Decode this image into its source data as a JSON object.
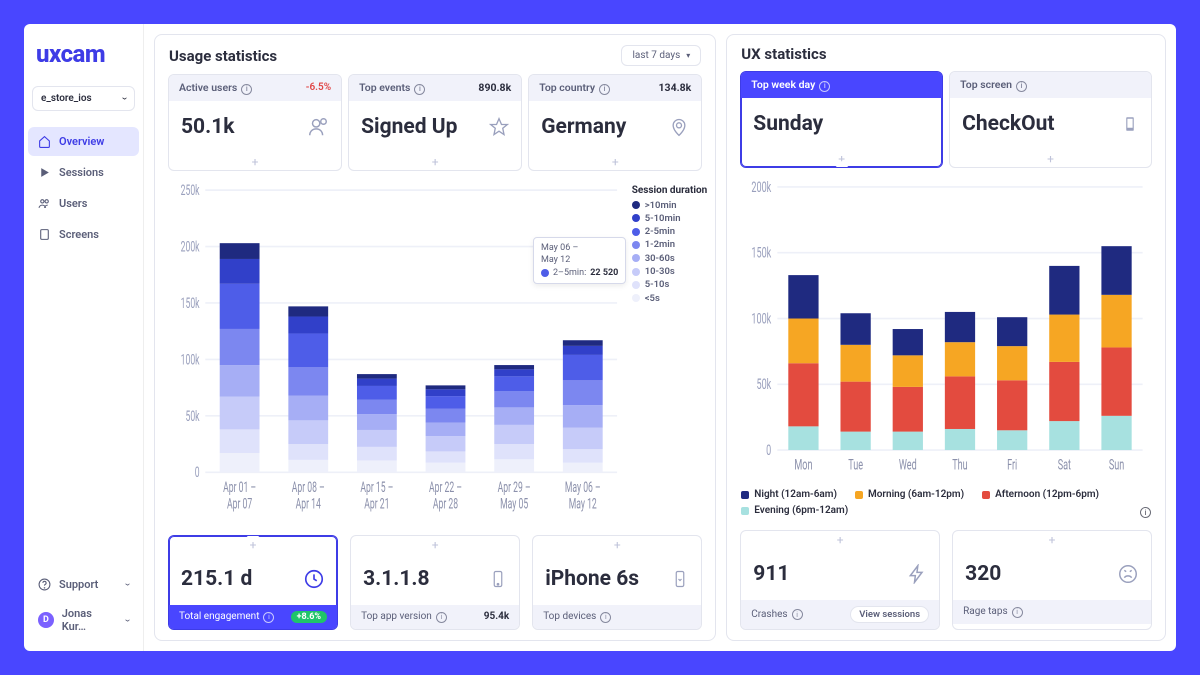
{
  "brand": {
    "part1": "ux",
    "part2": "cam"
  },
  "app_selector": {
    "name": "e_store_ios"
  },
  "nav": {
    "items": [
      {
        "label": "Overview",
        "icon": "home"
      },
      {
        "label": "Sessions",
        "icon": "play"
      },
      {
        "label": "Users",
        "icon": "users"
      },
      {
        "label": "Screens",
        "icon": "screen"
      }
    ]
  },
  "footer": {
    "support": "Support",
    "user_initial": "D",
    "user_name": "Jonas Kur…"
  },
  "usage": {
    "title": "Usage statistics",
    "range": "last 7 days",
    "top_metrics": [
      {
        "label": "Active users",
        "stat": "-6.5%",
        "value": "50.1k",
        "icon": "person"
      },
      {
        "label": "Top events",
        "stat": "890.8k",
        "value": "Signed Up",
        "icon": "star"
      },
      {
        "label": "Top country",
        "stat": "134.8k",
        "value": "Germany",
        "icon": "pin"
      }
    ],
    "bottom_metrics": [
      {
        "value": "215.1 d",
        "label": "Total engagement",
        "stat": "+8.6%",
        "icon": "clock"
      },
      {
        "value": "3.1.1.8",
        "label": "Top app version",
        "stat": "95.4k",
        "icon": "phone"
      },
      {
        "value": "iPhone 6s",
        "label": "Top devices",
        "stat": "",
        "icon": "phone-down"
      }
    ],
    "chart_tooltip": {
      "line1": "May 06 –",
      "line2": "May 12",
      "line3": "2–5min:",
      "value": "22 520"
    }
  },
  "ux": {
    "title": "UX statistics",
    "top_metrics": [
      {
        "label": "Top week day",
        "value": "Sunday"
      },
      {
        "label": "Top screen",
        "value": "CheckOut",
        "icon": "device"
      }
    ],
    "legend": [
      {
        "label": "Night (12am-6am)",
        "color": "#1f2a80"
      },
      {
        "label": "Morning (6am-12pm)",
        "color": "#f6a623"
      },
      {
        "label": "Afternoon (12pm-6pm)",
        "color": "#e34b3f"
      },
      {
        "label": "Evening (6pm-12am)",
        "color": "#a7e1e0"
      }
    ],
    "bottom_metrics": [
      {
        "value": "911",
        "label": "Crashes",
        "action": "View sessions",
        "icon": "bolt"
      },
      {
        "value": "320",
        "label": "Rage taps",
        "icon": "angry"
      }
    ]
  },
  "chart_data": [
    {
      "id": "session_duration",
      "type": "bar",
      "stacked": true,
      "title": "",
      "ylabel": "",
      "ylim": [
        0,
        250000
      ],
      "yticks": [
        0,
        50000,
        100000,
        150000,
        200000,
        250000
      ],
      "ytick_labels": [
        "0",
        "50k",
        "100k",
        "150k",
        "200k",
        "250k"
      ],
      "categories": [
        "Apr 01 –\nApr 07",
        "Apr 08 –\nApr 14",
        "Apr 15 –\nApr 21",
        "Apr 22 –\nApr 28",
        "Apr 29 –\nMay 05",
        "May 06 –\nMay 12"
      ],
      "legend_title": "Session duration",
      "series": [
        {
          "name": ">10min",
          "color": "#1f2a80",
          "values": [
            14000,
            9000,
            4000,
            3500,
            3800,
            5000
          ]
        },
        {
          "name": "5-10min",
          "color": "#3140c9",
          "values": [
            22000,
            15000,
            6500,
            6000,
            6200,
            8000
          ]
        },
        {
          "name": "2-5min",
          "color": "#4e5de8",
          "values": [
            40000,
            30000,
            12000,
            11000,
            13000,
            22520
          ]
        },
        {
          "name": "1-2min",
          "color": "#7c87f0",
          "values": [
            32000,
            25000,
            13000,
            12500,
            14500,
            22000
          ]
        },
        {
          "name": "30-60s",
          "color": "#a6aef5",
          "values": [
            28000,
            22000,
            14000,
            12000,
            15500,
            20000
          ]
        },
        {
          "name": "10-30s",
          "color": "#c6cbf9",
          "values": [
            29000,
            21000,
            15000,
            13500,
            17000,
            19000
          ]
        },
        {
          "name": "5-10s",
          "color": "#dfe2fb",
          "values": [
            21000,
            14000,
            12000,
            10000,
            13500,
            12000
          ]
        },
        {
          "name": "<5s",
          "color": "#eef0fb",
          "values": [
            17000,
            11000,
            10500,
            8500,
            11500,
            8480
          ]
        }
      ]
    },
    {
      "id": "weekday_sessions",
      "type": "bar",
      "stacked": true,
      "title": "",
      "ylabel": "",
      "ylim": [
        0,
        200000
      ],
      "yticks": [
        0,
        50000,
        100000,
        150000,
        200000
      ],
      "ytick_labels": [
        "0",
        "50k",
        "100k",
        "150k",
        "200k"
      ],
      "categories": [
        "Mon",
        "Tue",
        "Wed",
        "Thu",
        "Fri",
        "Sat",
        "Sun"
      ],
      "series": [
        {
          "name": "Evening (6pm-12am)",
          "color": "#a7e1e0",
          "values": [
            18000,
            14000,
            14000,
            16000,
            15000,
            22000,
            26000
          ]
        },
        {
          "name": "Afternoon (12pm-6pm)",
          "color": "#e34b3f",
          "values": [
            48000,
            38000,
            34000,
            40000,
            38000,
            45000,
            52000
          ]
        },
        {
          "name": "Morning (6am-12pm)",
          "color": "#f6a623",
          "values": [
            34000,
            28000,
            24000,
            26000,
            26000,
            36000,
            40000
          ]
        },
        {
          "name": "Night (12am-6am)",
          "color": "#1f2a80",
          "values": [
            33000,
            24000,
            20000,
            23000,
            22000,
            37000,
            37000
          ]
        }
      ]
    }
  ]
}
